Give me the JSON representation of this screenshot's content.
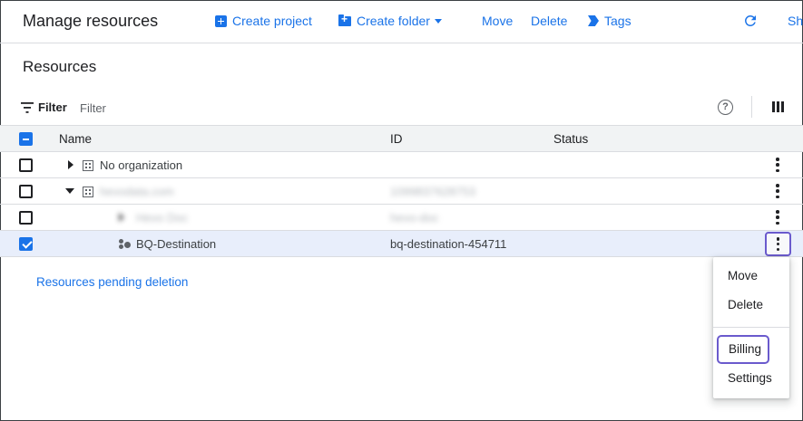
{
  "header": {
    "title": "Manage resources",
    "create_project": "Create project",
    "create_folder": "Create folder",
    "move": "Move",
    "delete": "Delete",
    "tags": "Tags",
    "share_partial": "Sh"
  },
  "section": {
    "title": "Resources"
  },
  "filter": {
    "label": "Filter",
    "placeholder": "Filter"
  },
  "table": {
    "columns": {
      "name": "Name",
      "id": "ID",
      "status": "Status"
    },
    "rows": [
      {
        "name": "No organization",
        "id": "",
        "status": "",
        "checked": false,
        "kind": "organization",
        "expanded": false
      },
      {
        "name": "hevodata.com",
        "id": "109983762875​3",
        "status": "",
        "checked": false,
        "kind": "organization",
        "expanded": true,
        "blurred": true
      },
      {
        "name": "Hevo Doc",
        "id": "hevo-doc",
        "status": "",
        "checked": false,
        "kind": "project",
        "blurred": true
      },
      {
        "name": "BQ-Destination",
        "id": "bq-destination-454711",
        "status": "",
        "checked": true,
        "kind": "project",
        "selected": true
      }
    ]
  },
  "links": {
    "pending_deletion": "Resources pending deletion"
  },
  "context_menu": {
    "items": [
      "Move",
      "Delete",
      "Billing",
      "Settings"
    ],
    "highlighted": "Billing"
  },
  "colors": {
    "accent": "#1a73e8",
    "highlight_border": "#6a5acd",
    "selected_row": "#e8eefb"
  }
}
